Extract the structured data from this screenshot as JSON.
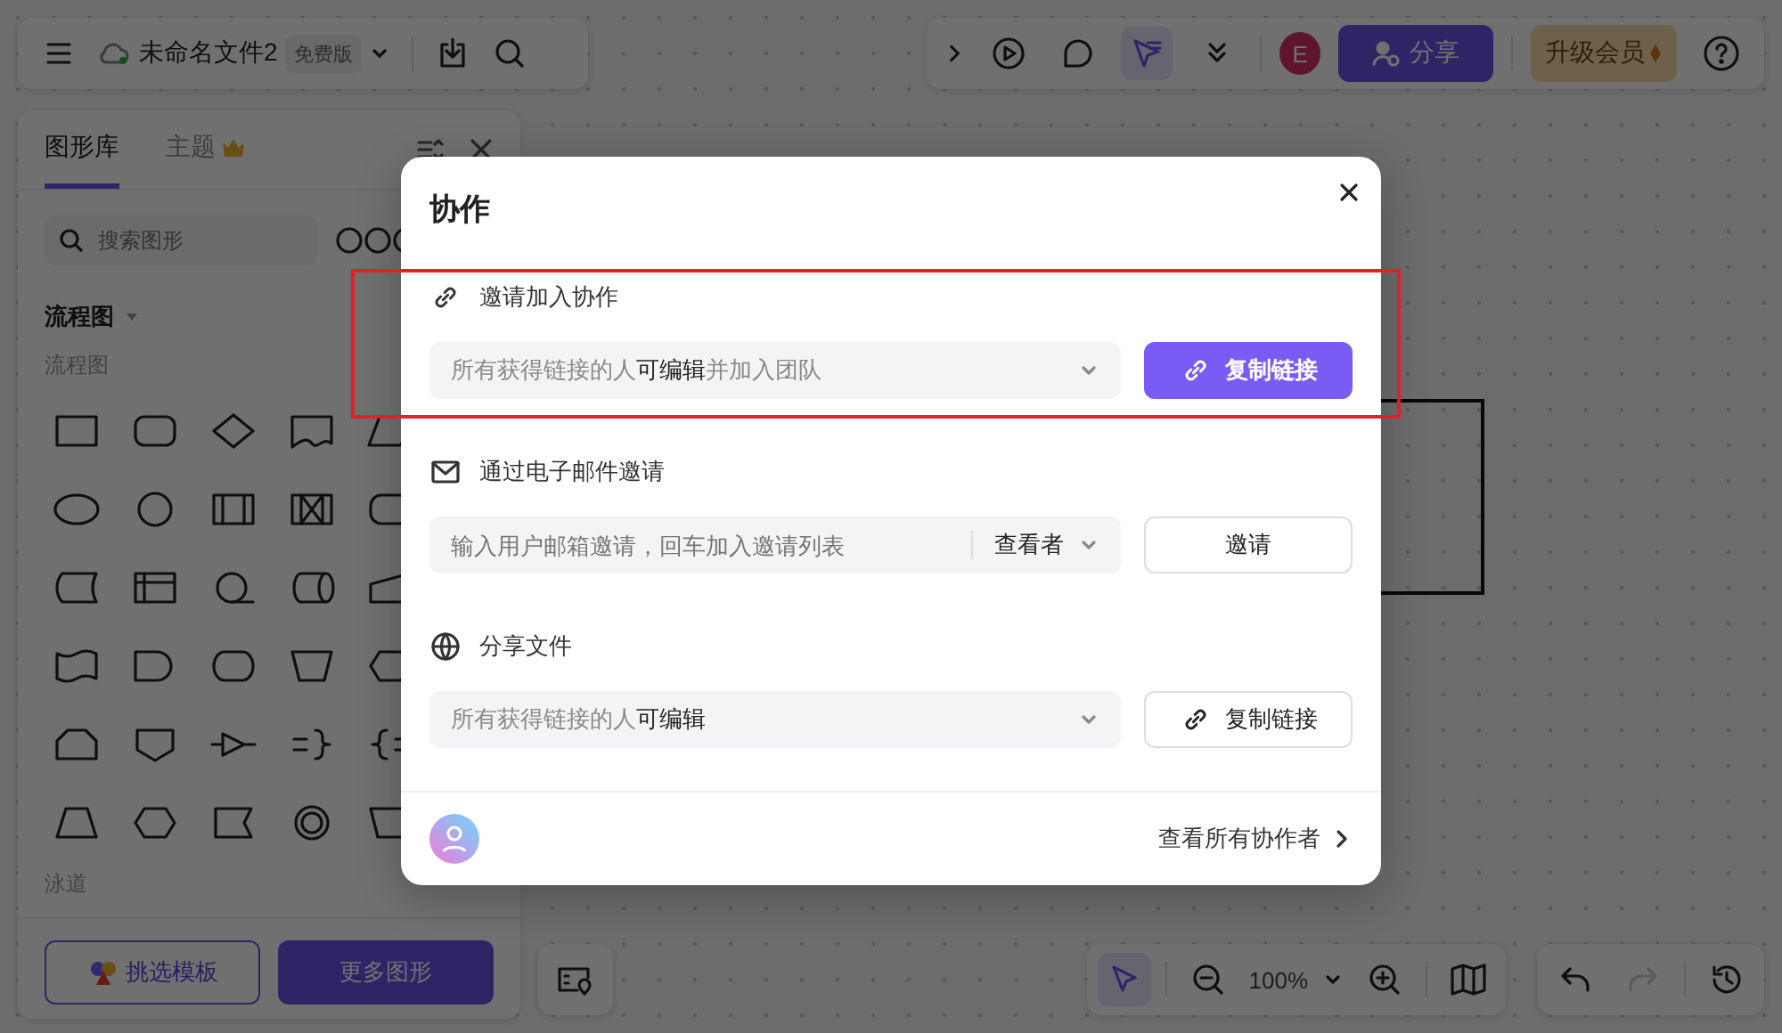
{
  "top_toolbar": {
    "file_name": "未命名文件2",
    "plan_badge": "免费版"
  },
  "right_toolbar": {
    "pointer_selected": true,
    "avatar": "E",
    "share_button": "分享",
    "upgrade_button": "升级会员"
  },
  "left_panel": {
    "tabs": [
      {
        "label": "图形库",
        "selected": true
      },
      {
        "label": "主题",
        "selected": false
      }
    ],
    "search": {
      "placeholder": "搜索图形"
    },
    "category": "流程图",
    "group_title": "流程图",
    "lane_title": "泳道",
    "buttons": [
      {
        "label": "挑选模板",
        "kind": "outline"
      },
      {
        "label": "更多图形",
        "kind": "primary"
      }
    ]
  },
  "bottom_toolbar": {
    "pointer_selected": true,
    "zoom": "100%"
  },
  "history_toolbar": {
    "redo_disabled": true
  },
  "dialog": {
    "title": "协作",
    "sections": [
      {
        "kind": "link",
        "heading": "邀请加入协作",
        "select": "所有获得链接的人**可编辑**并加入团队",
        "button": {
          "label": "复制链接",
          "kind": "primary"
        }
      },
      {
        "kind": "email",
        "heading": "通过电子邮件邀请",
        "placeholder": "输入用户邮箱邀请，回车加入邀请列表",
        "role": "查看者",
        "button": {
          "label": "邀请",
          "kind": "plain"
        }
      },
      {
        "kind": "share",
        "heading": "分享文件",
        "select": "所有获得链接的人**可编辑**",
        "button": {
          "label": "复制链接",
          "kind": "outline"
        }
      }
    ],
    "footer_link": "查看所有协作者"
  }
}
